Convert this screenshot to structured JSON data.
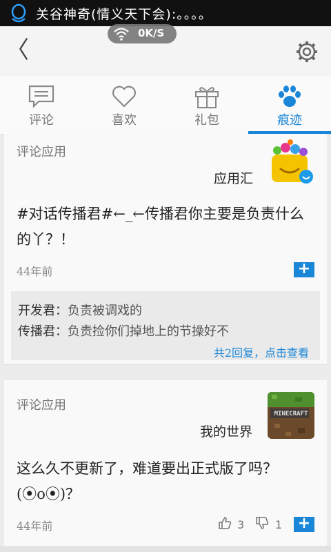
{
  "status_bar": {
    "notification_text": "关谷神奇(情义天下会):。。。。"
  },
  "network_indicator": {
    "speed": "0K/S"
  },
  "tabs": [
    {
      "label": "评论",
      "icon": "comment-icon"
    },
    {
      "label": "喜欢",
      "icon": "heart-icon"
    },
    {
      "label": "礼包",
      "icon": "gift-icon"
    },
    {
      "label": "痕迹",
      "icon": "paw-icon",
      "active": true
    }
  ],
  "accent_color": "#1a86d8",
  "posts": [
    {
      "tag": "评论应用",
      "app_name": "应用汇",
      "content": "#对话传播君#←_←传播君你主要是负责什么的丫？！",
      "time": "44年前",
      "replies": [
        {
          "author": "开发君：",
          "text": "负责被调戏的"
        },
        {
          "author": "传播君：",
          "text": "负责捡你们掉地上的节操好不"
        }
      ],
      "more_replies": "共2回复，点击查看"
    },
    {
      "tag": "评论应用",
      "app_name": "我的世界",
      "content": "这么久不更新了，难道要出正式版了吗？(⦿o⦿)？",
      "time": "44年前",
      "likes": "3",
      "dislikes": "1"
    }
  ]
}
